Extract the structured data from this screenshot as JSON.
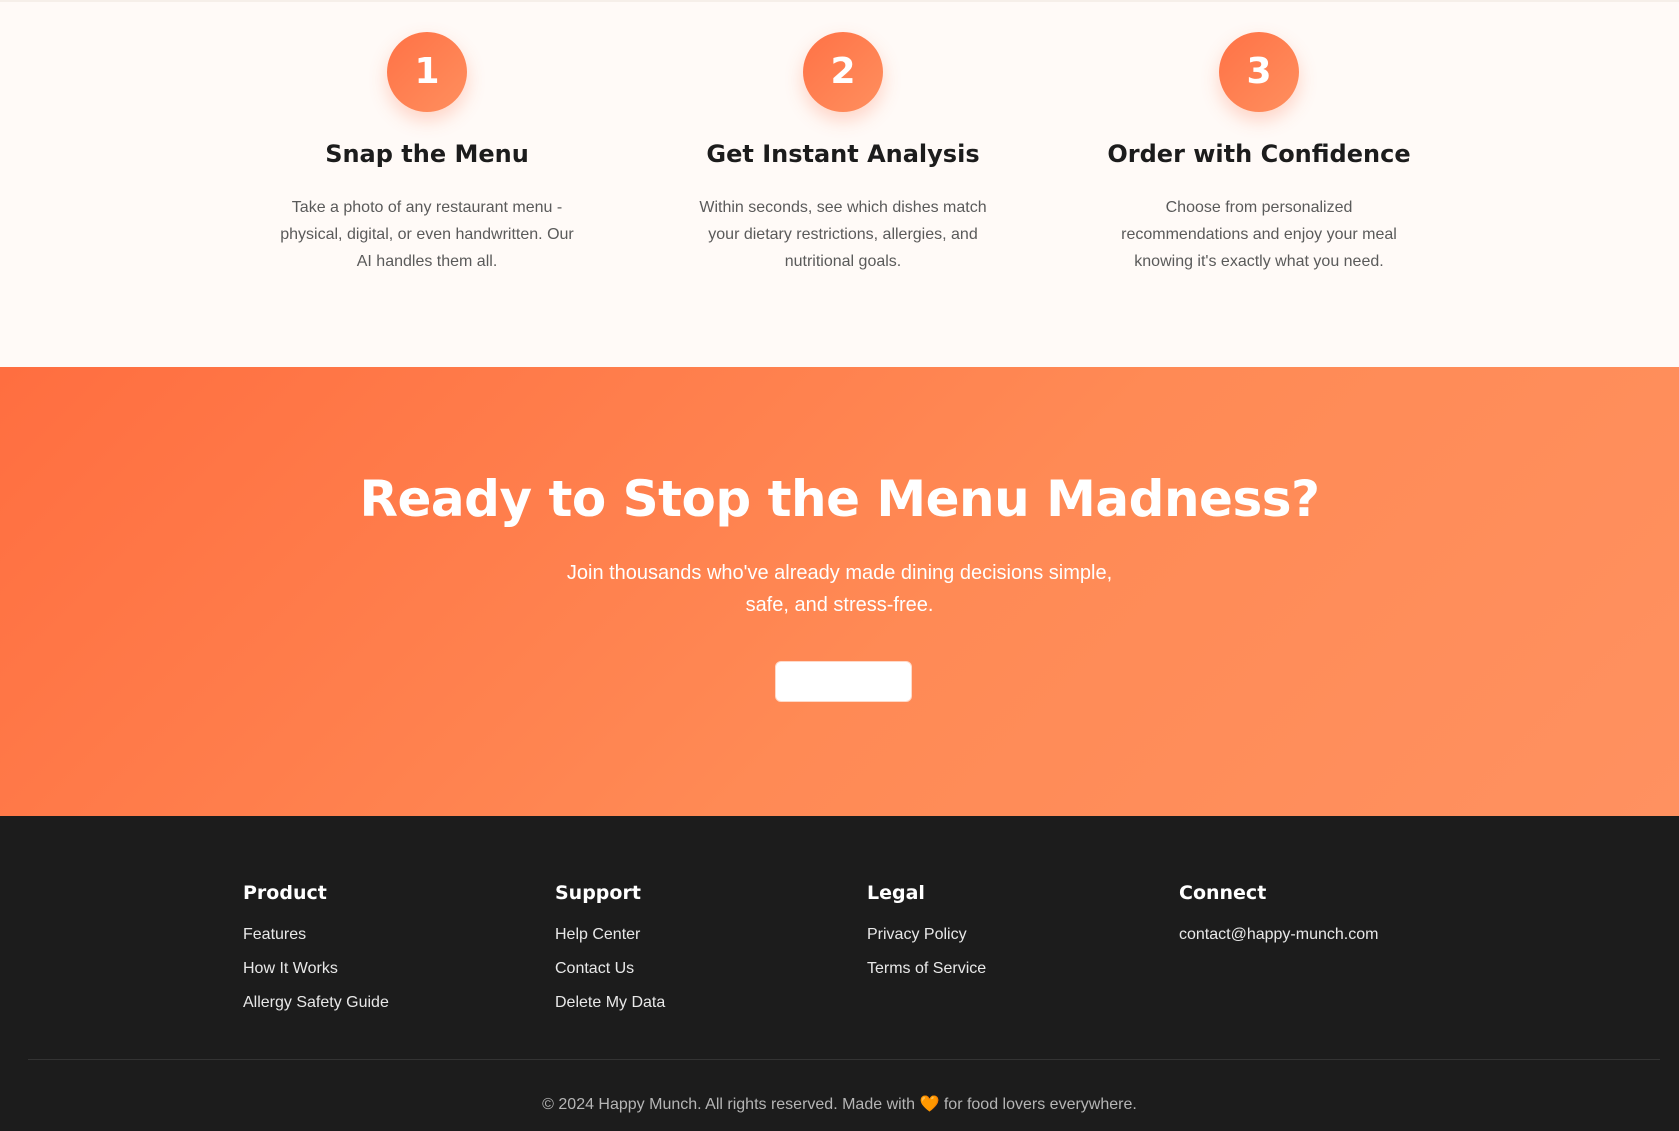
{
  "steps": [
    {
      "number": "1",
      "title": "Snap the Menu",
      "description": "Take a photo of any restaurant menu - physical, digital, or even handwritten. Our AI handles them all."
    },
    {
      "number": "2",
      "title": "Get Instant Analysis",
      "description": "Within seconds, see which dishes match your dietary restrictions, allergies, and nutritional goals."
    },
    {
      "number": "3",
      "title": "Order with Confidence",
      "description": "Choose from personalized recommendations and enjoy your meal knowing it's exactly what you need."
    }
  ],
  "cta": {
    "title": "Ready to Stop the Menu Madness?",
    "subtitle": "Join thousands who've already made dining decisions simple, safe, and stress-free.",
    "button_label": ""
  },
  "footer": {
    "columns": [
      {
        "title": "Product",
        "links": [
          "Features",
          "How It Works",
          "Allergy Safety Guide"
        ]
      },
      {
        "title": "Support",
        "links": [
          "Help Center",
          "Contact Us",
          "Delete My Data"
        ]
      },
      {
        "title": "Legal",
        "links": [
          "Privacy Policy",
          "Terms of Service"
        ]
      },
      {
        "title": "Connect",
        "links": [
          "contact@happy-munch.com"
        ]
      }
    ],
    "copyright_before": "© 2024 Happy Munch. All rights reserved. Made with",
    "heart": "🧡",
    "copyright_after": "for food lovers everywhere."
  },
  "colors": {
    "accent": "#ff6e40",
    "footer_bg": "#1c1c1c",
    "page_bg": "#fffaf7"
  }
}
